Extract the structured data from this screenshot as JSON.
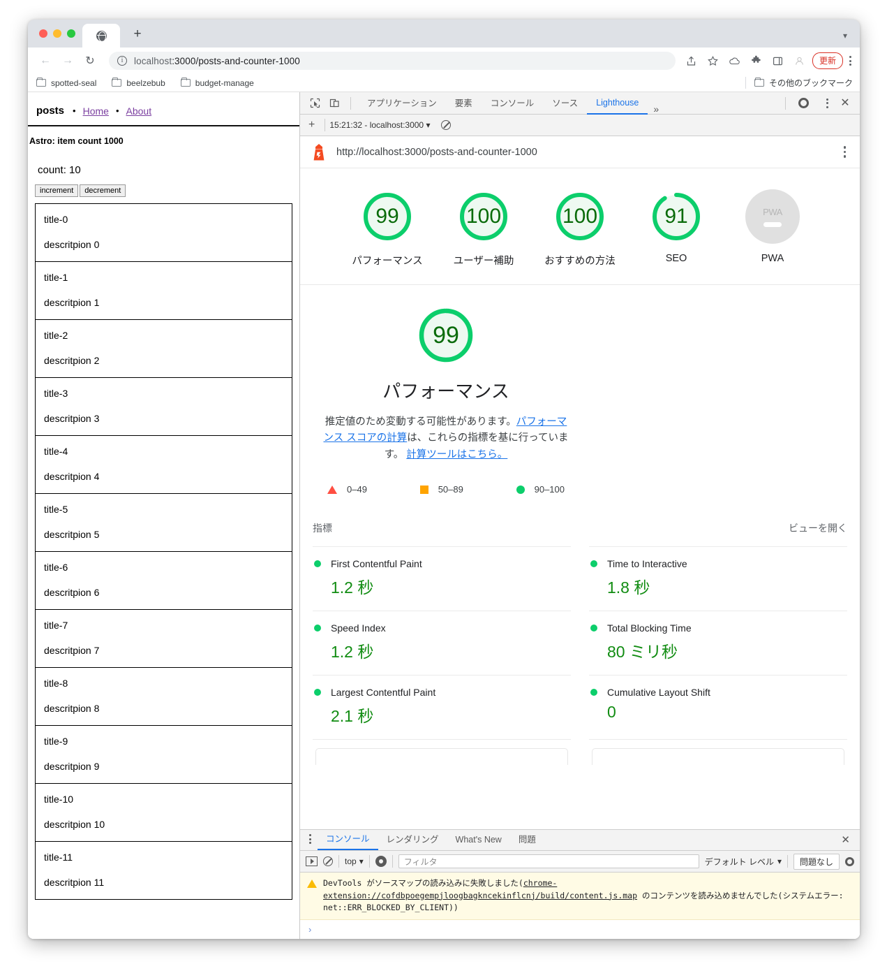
{
  "browser": {
    "tab_favicon": "globe-icon",
    "new_tab_label": "+",
    "nav": {
      "back": "←",
      "forward": "→",
      "reload": "↻"
    },
    "url_scheme_dim": "localhost",
    "url_text": ":3000/posts-and-counter-1000",
    "update_button": "更新",
    "bookmarks": [
      {
        "label": "spotted-seal"
      },
      {
        "label": "beelzebub"
      },
      {
        "label": "budget-manage"
      }
    ],
    "other_bookmarks": "その他のブックマーク"
  },
  "page": {
    "site_title": "posts",
    "nav": [
      {
        "label": "Home"
      },
      {
        "label": "About"
      }
    ],
    "astro_line": "Astro: item count 1000",
    "count_line": "count: 10",
    "increment_label": "increment",
    "decrement_label": "decrement",
    "posts": [
      {
        "title": "title-0",
        "desc": "descritpion 0"
      },
      {
        "title": "title-1",
        "desc": "descritpion 1"
      },
      {
        "title": "title-2",
        "desc": "descritpion 2"
      },
      {
        "title": "title-3",
        "desc": "descritpion 3"
      },
      {
        "title": "title-4",
        "desc": "descritpion 4"
      },
      {
        "title": "title-5",
        "desc": "descritpion 5"
      },
      {
        "title": "title-6",
        "desc": "descritpion 6"
      },
      {
        "title": "title-7",
        "desc": "descritpion 7"
      },
      {
        "title": "title-8",
        "desc": "descritpion 8"
      },
      {
        "title": "title-9",
        "desc": "descritpion 9"
      },
      {
        "title": "title-10",
        "desc": "descritpion 10"
      },
      {
        "title": "title-11",
        "desc": "descritpion 11"
      }
    ]
  },
  "devtools": {
    "tabs": [
      {
        "label": "アプリケーション",
        "active": false
      },
      {
        "label": "要素",
        "active": false
      },
      {
        "label": "コンソール",
        "active": false
      },
      {
        "label": "ソース",
        "active": false
      },
      {
        "label": "Lighthouse",
        "active": true
      }
    ],
    "more_tabs": "»"
  },
  "lighthouse": {
    "run_label": "15:21:32 - localhost:3000",
    "url": "http://localhost:3000/posts-and-counter-1000",
    "gauges": [
      {
        "score": "99",
        "label": "パフォーマンス"
      },
      {
        "score": "100",
        "label": "ユーザー補助"
      },
      {
        "score": "100",
        "label": "おすすめの方法"
      },
      {
        "score": "91",
        "label": "SEO"
      }
    ],
    "pwa": {
      "badge": "PWA",
      "label": "PWA"
    },
    "perf": {
      "score": "99",
      "title": "パフォーマンス",
      "desc_1": "推定値のため変動する可能性があります。",
      "desc_link_1": "パフォーマンス スコアの計算",
      "desc_2": "は、これらの指標を基に行っています。",
      "desc_link_2": "計算ツールはこちら。"
    },
    "legend": [
      {
        "shape": "triangle-icon",
        "range": "0–49"
      },
      {
        "shape": "square-icon",
        "range": "50–89"
      },
      {
        "shape": "circle-icon",
        "range": "90–100"
      }
    ],
    "metrics_header": "指標",
    "open_view": "ビューを開く",
    "metrics": [
      {
        "name": "First Contentful Paint",
        "value": "1.2 秒"
      },
      {
        "name": "Time to Interactive",
        "value": "1.8 秒"
      },
      {
        "name": "Speed Index",
        "value": "1.2 秒"
      },
      {
        "name": "Total Blocking Time",
        "value": "80 ミリ秒"
      },
      {
        "name": "Largest Contentful Paint",
        "value": "2.1 秒"
      },
      {
        "name": "Cumulative Layout Shift",
        "value": "0"
      }
    ],
    "colors": {
      "pass": "#0cce6b",
      "average": "#ffa400",
      "fail": "#ff4e42",
      "value_text": "#118c12",
      "link": "#1a73e8"
    }
  },
  "console": {
    "tabs": [
      {
        "label": "コンソール",
        "active": true
      },
      {
        "label": "レンダリング",
        "active": false
      },
      {
        "label": "What's New",
        "active": false
      },
      {
        "label": "問題",
        "active": false
      }
    ],
    "context": "top",
    "filter_placeholder": "フィルタ",
    "level": "デフォルト レベル",
    "no_issues": "問題なし",
    "warning_part1": "DevTools がソースマップの読み込みに失敗しました(",
    "warning_link": "chrome-extension://cofdbpoegempjloogbagkncekinflcnj/build/content.js.map",
    "warning_part2": " のコンテンツを読み込めませんでした(システムエラー: net::ERR_BLOCKED_BY_CLIENT))",
    "prompt": "›"
  }
}
